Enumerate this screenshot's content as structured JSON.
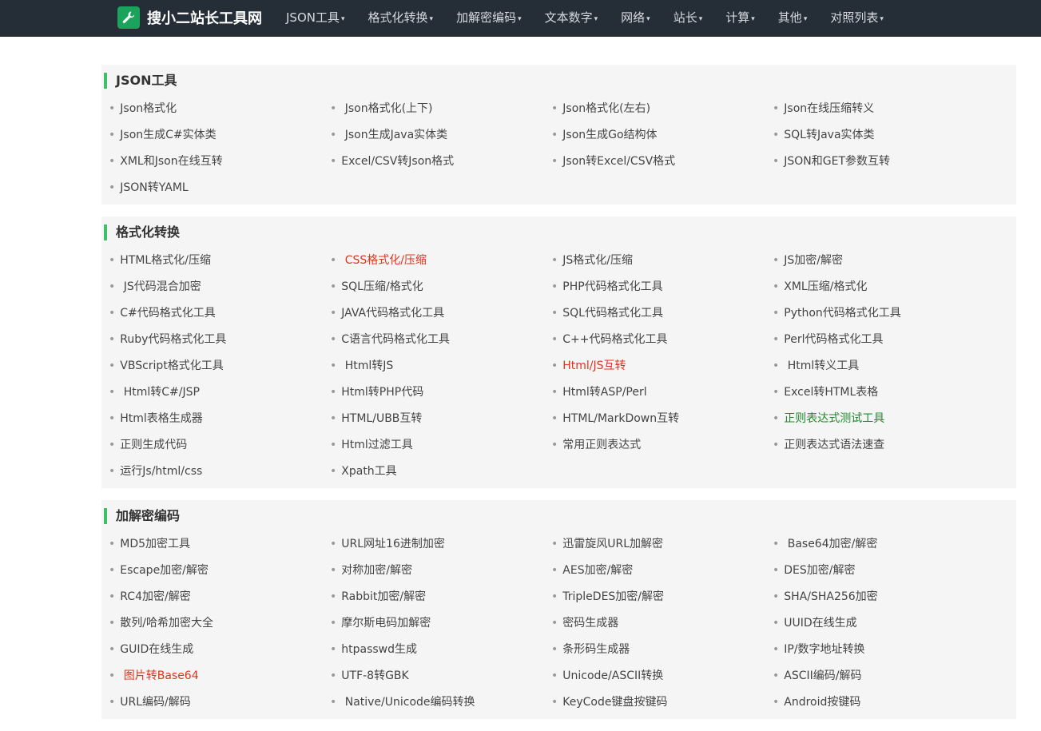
{
  "header": {
    "brand": "搜小二站长工具网",
    "nav": [
      "JSON工具",
      "格式化转换",
      "加解密编码",
      "文本数字",
      "网络",
      "站长",
      "计算",
      "其他",
      "对照列表"
    ],
    "caret": "▾"
  },
  "sections": [
    {
      "title": "JSON工具",
      "links": [
        {
          "text": "Json格式化",
          "style": ""
        },
        {
          "text": " Json格式化(上下)",
          "style": ""
        },
        {
          "text": "Json格式化(左右)",
          "style": ""
        },
        {
          "text": "Json在线压缩转义",
          "style": ""
        },
        {
          "text": "Json生成C#实体类",
          "style": ""
        },
        {
          "text": " Json生成Java实体类",
          "style": ""
        },
        {
          "text": "Json生成Go结构体",
          "style": ""
        },
        {
          "text": "SQL转Java实体类",
          "style": ""
        },
        {
          "text": "XML和Json在线互转",
          "style": ""
        },
        {
          "text": "Excel/CSV转Json格式",
          "style": ""
        },
        {
          "text": "Json转Excel/CSV格式",
          "style": ""
        },
        {
          "text": "JSON和GET参数互转",
          "style": ""
        },
        {
          "text": "JSON转YAML",
          "style": ""
        }
      ]
    },
    {
      "title": "格式化转换",
      "links": [
        {
          "text": "HTML格式化/压缩",
          "style": ""
        },
        {
          "text": " CSS格式化/压缩",
          "style": "red"
        },
        {
          "text": "JS格式化/压缩",
          "style": ""
        },
        {
          "text": "JS加密/解密",
          "style": ""
        },
        {
          "text": " JS代码混合加密",
          "style": ""
        },
        {
          "text": "SQL压缩/格式化",
          "style": ""
        },
        {
          "text": "PHP代码格式化工具",
          "style": ""
        },
        {
          "text": "XML压缩/格式化",
          "style": ""
        },
        {
          "text": "C#代码格式化工具",
          "style": ""
        },
        {
          "text": "JAVA代码格式化工具",
          "style": ""
        },
        {
          "text": "SQL代码格式化工具",
          "style": ""
        },
        {
          "text": "Python代码格式化工具",
          "style": ""
        },
        {
          "text": "Ruby代码格式化工具",
          "style": ""
        },
        {
          "text": "C语言代码格式化工具",
          "style": ""
        },
        {
          "text": "C++代码格式化工具",
          "style": ""
        },
        {
          "text": "Perl代码格式化工具",
          "style": ""
        },
        {
          "text": "VBScript格式化工具",
          "style": ""
        },
        {
          "text": " Html转JS",
          "style": ""
        },
        {
          "text": "Html/JS互转",
          "style": "red"
        },
        {
          "text": " Html转义工具",
          "style": ""
        },
        {
          "text": " Html转C#/JSP",
          "style": ""
        },
        {
          "text": "Html转PHP代码",
          "style": ""
        },
        {
          "text": "Html转ASP/Perl",
          "style": ""
        },
        {
          "text": "Excel转HTML表格",
          "style": ""
        },
        {
          "text": "Html表格生成器",
          "style": ""
        },
        {
          "text": "HTML/UBB互转",
          "style": ""
        },
        {
          "text": "HTML/MarkDown互转",
          "style": ""
        },
        {
          "text": "正则表达式测试工具",
          "style": "green"
        },
        {
          "text": "正则生成代码",
          "style": ""
        },
        {
          "text": "Html过滤工具",
          "style": ""
        },
        {
          "text": "常用正则表达式",
          "style": ""
        },
        {
          "text": "正则表达式语法速查",
          "style": ""
        },
        {
          "text": "运行Js/html/css",
          "style": ""
        },
        {
          "text": "Xpath工具",
          "style": ""
        }
      ]
    },
    {
      "title": "加解密编码",
      "links": [
        {
          "text": "MD5加密工具",
          "style": ""
        },
        {
          "text": "URL网址16进制加密",
          "style": ""
        },
        {
          "text": "迅雷旋风URL加解密",
          "style": ""
        },
        {
          "text": " Base64加密/解密",
          "style": ""
        },
        {
          "text": "Escape加密/解密",
          "style": ""
        },
        {
          "text": "对称加密/解密",
          "style": ""
        },
        {
          "text": "AES加密/解密",
          "style": ""
        },
        {
          "text": "DES加密/解密",
          "style": ""
        },
        {
          "text": "RC4加密/解密",
          "style": ""
        },
        {
          "text": "Rabbit加密/解密",
          "style": ""
        },
        {
          "text": "TripleDES加密/解密",
          "style": ""
        },
        {
          "text": "SHA/SHA256加密",
          "style": ""
        },
        {
          "text": "散列/哈希加密大全",
          "style": ""
        },
        {
          "text": "摩尔斯电码加解密",
          "style": ""
        },
        {
          "text": "密码生成器",
          "style": ""
        },
        {
          "text": "UUID在线生成",
          "style": ""
        },
        {
          "text": "GUID在线生成",
          "style": ""
        },
        {
          "text": "htpasswd生成",
          "style": ""
        },
        {
          "text": "条形码生成器",
          "style": ""
        },
        {
          "text": "IP/数字地址转换",
          "style": ""
        },
        {
          "text": " 图片转Base64",
          "style": "red"
        },
        {
          "text": "UTF-8转GBK",
          "style": ""
        },
        {
          "text": "Unicode/ASCII转换",
          "style": ""
        },
        {
          "text": "ASCII编码/解码",
          "style": ""
        },
        {
          "text": "URL编码/解码",
          "style": ""
        },
        {
          "text": " Native/Unicode编码转换",
          "style": ""
        },
        {
          "text": "KeyCode键盘按键码",
          "style": ""
        },
        {
          "text": "Android按键码",
          "style": ""
        }
      ]
    }
  ]
}
